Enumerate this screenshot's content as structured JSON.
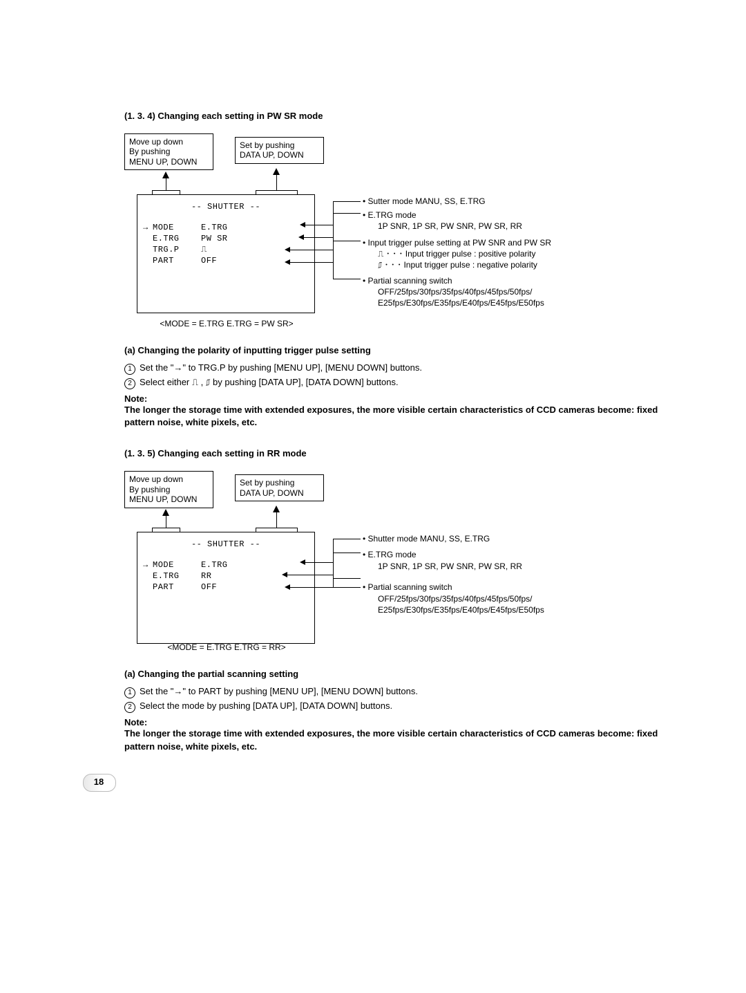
{
  "s134": {
    "heading": "(1. 3. 4)   Changing each setting in PW SR mode",
    "labelLeft": "Move up down\nBy pushing\nMENU UP, DOWN",
    "labelRight": "Set by pushing\nDATA UP, DOWN",
    "menu": {
      "title": "-- SHUTTER --",
      "rows": [
        {
          "cursor": "→",
          "key": "MODE",
          "val": "E.TRG"
        },
        {
          "cursor": "",
          "key": "E.TRG",
          "val": "PW SR"
        },
        {
          "cursor": "",
          "key": "TRG.P",
          "val": "⎍"
        },
        {
          "cursor": "",
          "key": "PART",
          "val": "OFF"
        }
      ]
    },
    "bullets": {
      "b1": "• Sutter mode   MANU, SS, E.TRG",
      "b2a": "• E.TRG mode",
      "b2b": "1P SNR, 1P SR, PW SNR, PW SR, RR",
      "b3a": "• Input trigger pulse setting at PW SNR and PW SR",
      "b3b": "⎍ ･ ･ ･ Input trigger pulse : positive polarity",
      "b3c": "⎎ ･ ･ ･ Input trigger pulse : negative polarity",
      "b4a": "• Partial scanning switch",
      "b4b": "OFF/25fps/30fps/35fps/40fps/45fps/50fps/",
      "b4c": "E25fps/E30fps/E35fps/E40fps/E45fps/E50fps"
    },
    "caption": "<MODE = E.TRG   E.TRG = PW SR>",
    "subA": "(a)   Changing the polarity of inputting trigger pulse setting",
    "step1": "Set the \"→\" to TRG.P by pushing [MENU UP], [MENU DOWN] buttons.",
    "step2": "Select either ⎍ , ⎎ by pushing [DATA UP], [DATA DOWN] buttons.",
    "noteLabel": "Note:",
    "noteBody": "The longer the storage time with extended exposures, the more visible certain characteristics of CCD cameras become: fixed pattern noise, white pixels, etc."
  },
  "s135": {
    "heading": "(1. 3. 5)   Changing each setting in RR mode",
    "labelLeft": "Move up down\nBy pushing\nMENU UP, DOWN",
    "labelRight": "Set by pushing\nDATA UP, DOWN",
    "menu": {
      "title": "-- SHUTTER --",
      "rows": [
        {
          "cursor": "→",
          "key": "MODE",
          "val": "E.TRG"
        },
        {
          "cursor": "",
          "key": "E.TRG",
          "val": "RR"
        },
        {
          "cursor": "",
          "key": "PART",
          "val": "OFF"
        }
      ]
    },
    "bullets": {
      "b1": "• Shutter mode   MANU, SS, E.TRG",
      "b2a": "• E.TRG mode",
      "b2b": "1P SNR, 1P SR, PW SNR, PW SR, RR",
      "b3a": "• Partial scanning switch",
      "b3b": "OFF/25fps/30fps/35fps/40fps/45fps/50fps/",
      "b3c": "E25fps/E30fps/E35fps/E40fps/E45fps/E50fps"
    },
    "caption": "<MODE = E.TRG   E.TRG = RR>",
    "subA": "(a)   Changing the partial scanning setting",
    "step1": "Set the \"→\" to PART by pushing [MENU UP], [MENU DOWN] buttons.",
    "step2": "Select the mode by pushing [DATA UP], [DATA DOWN] buttons.",
    "noteLabel": "Note:",
    "noteBody": "The longer the storage time with extended exposures, the more visible certain characteristics of CCD cameras become: fixed pattern noise, white pixels, etc."
  },
  "pageNumber": "18"
}
